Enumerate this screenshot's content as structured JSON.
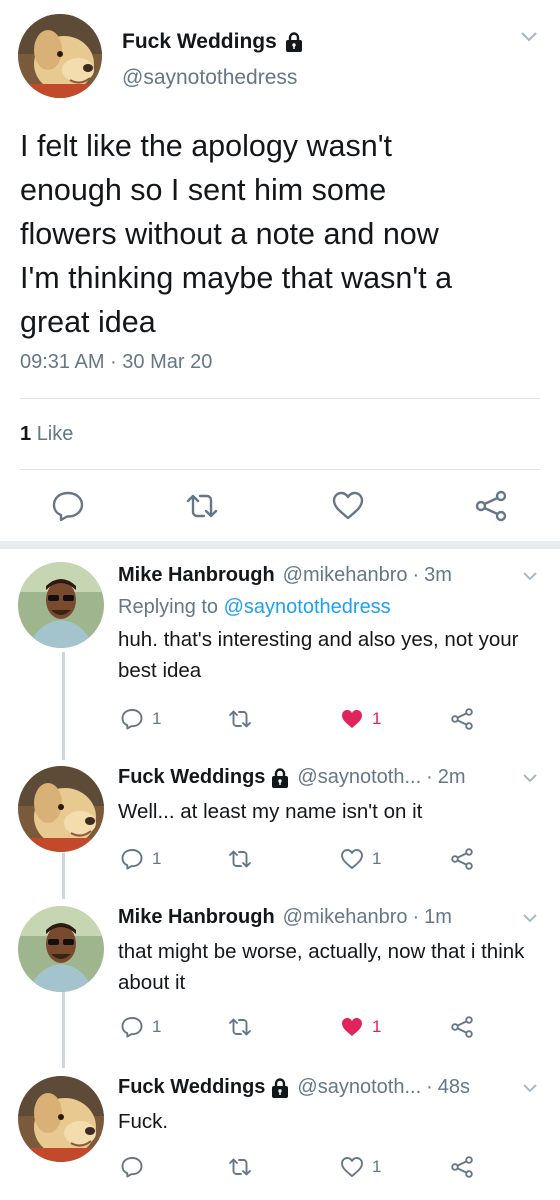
{
  "main_tweet": {
    "name": "Fuck Weddings",
    "handle": "@saynotothedress",
    "avatar": "dog-avatar",
    "text": "I felt like the apology wasn't\nenough so I sent him some\nflowers without a note and now\nI'm thinking maybe that wasn't a\ngreat idea",
    "time": "09:31 AM · 30 Mar 20",
    "likes_count": "1",
    "likes_label": "Like"
  },
  "replies": [
    {
      "name": "Mike Hanbrough",
      "handle": "@mikehanbro",
      "time": "3m",
      "replying_prefix": "Replying to ",
      "replying_to": "@saynotothedress",
      "text": "huh. that's interesting and also yes, not your best idea",
      "reply_count": "1",
      "like_count": "1",
      "liked": true
    },
    {
      "name": "Fuck Weddings",
      "handle": "@saynototh...",
      "time": "2m",
      "text": "Well... at least my name isn't on it",
      "reply_count": "1",
      "like_count": "1",
      "liked": false
    },
    {
      "name": "Mike Hanbrough",
      "handle": "@mikehanbro",
      "time": "1m",
      "text": "that might be worse, actually, now that i think about it",
      "reply_count": "1",
      "like_count": "1",
      "liked": true
    },
    {
      "name": "Fuck Weddings",
      "handle": "@saynototh...",
      "time": "48s",
      "text": "Fuck.",
      "reply_count": "",
      "like_count": "1",
      "liked": false
    }
  ],
  "ui": {
    "dot": "·",
    "icons": {
      "reply": "speech-bubble-icon",
      "retweet": "retweet-icon",
      "like": "heart-icon",
      "share": "share-icon",
      "protected": "lock-icon",
      "more": "chevron-down-icon"
    }
  },
  "colors": {
    "text": "#14171a",
    "secondary": "#657786",
    "link": "#1da1f2",
    "like": "#e0245e",
    "divider": "#e1e8ed",
    "separator": "#e6ecf0"
  }
}
